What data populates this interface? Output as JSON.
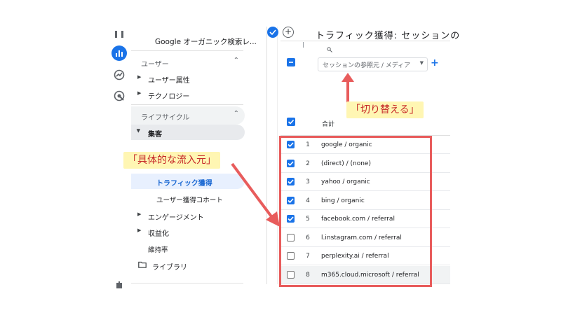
{
  "header": {
    "title": "トラフィック獲得: セッションの"
  },
  "sidebar": {
    "report_title": "Google オーガニック検索レ...",
    "section_user": "ユーザー",
    "user_items": [
      "ユーザー属性",
      "テクノロジー"
    ],
    "section_lifecycle": "ライフサイクル",
    "acquisition": "集客",
    "traffic_acquisition": "トラフィック獲得",
    "user_acquisition_cohort": "ユーザー獲得コホート",
    "engagement": "エンゲージメント",
    "monetization": "収益化",
    "retention": "維持率",
    "library": "ライブラリ"
  },
  "table": {
    "dimension_selector": "セッションの参照元 / メディア",
    "total_label": "合計",
    "rows": [
      {
        "num": "1",
        "label": "google / organic",
        "checked": true
      },
      {
        "num": "2",
        "label": "(direct) / (none)",
        "checked": true
      },
      {
        "num": "3",
        "label": "yahoo / organic",
        "checked": true
      },
      {
        "num": "4",
        "label": "bing / organic",
        "checked": true
      },
      {
        "num": "5",
        "label": "facebook.com / referral",
        "checked": true
      },
      {
        "num": "6",
        "label": "l.instagram.com / referral",
        "checked": false
      },
      {
        "num": "7",
        "label": "perplexity.ai / referral",
        "checked": false
      },
      {
        "num": "8",
        "label": "m365.cloud.microsoft / referral",
        "checked": false
      }
    ]
  },
  "annotations": {
    "switch_label": "「切り替える」",
    "source_label": "「具体的な流入元」"
  },
  "colors": {
    "accent": "#1a73e8",
    "annotation_red": "#e85c5c",
    "callout_bg": "#fff6b3",
    "selected_bg": "#e8f0fe"
  }
}
